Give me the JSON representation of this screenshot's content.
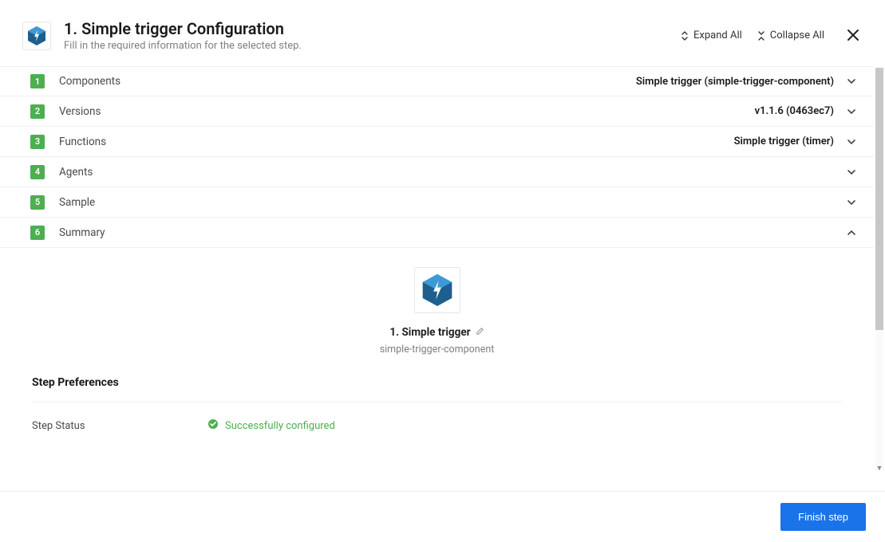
{
  "header": {
    "title": "1. Simple trigger Configuration",
    "subtitle": "Fill in the required information for the selected step.",
    "expand_label": "Expand All",
    "collapse_label": "Collapse All"
  },
  "sections": [
    {
      "num": "1",
      "label": "Components",
      "value": "Simple trigger (simple-trigger-component)",
      "expanded": false
    },
    {
      "num": "2",
      "label": "Versions",
      "value": "v1.1.6 (0463ec7)",
      "expanded": false
    },
    {
      "num": "3",
      "label": "Functions",
      "value": "Simple trigger (timer)",
      "expanded": false
    },
    {
      "num": "4",
      "label": "Agents",
      "value": "",
      "expanded": false
    },
    {
      "num": "5",
      "label": "Sample",
      "value": "",
      "expanded": false
    },
    {
      "num": "6",
      "label": "Summary",
      "value": "",
      "expanded": true
    }
  ],
  "summary": {
    "title": "1. Simple trigger",
    "subtitle": "simple-trigger-component",
    "prefs_heading": "Step Preferences",
    "status_label": "Step Status",
    "status_value": "Successfully configured"
  },
  "footer": {
    "finish_label": "Finish step"
  },
  "colors": {
    "accent_green": "#4caf50",
    "accent_blue": "#1a73e8",
    "hex_dark": "#1e5f8e",
    "hex_light": "#3c9bd6"
  }
}
